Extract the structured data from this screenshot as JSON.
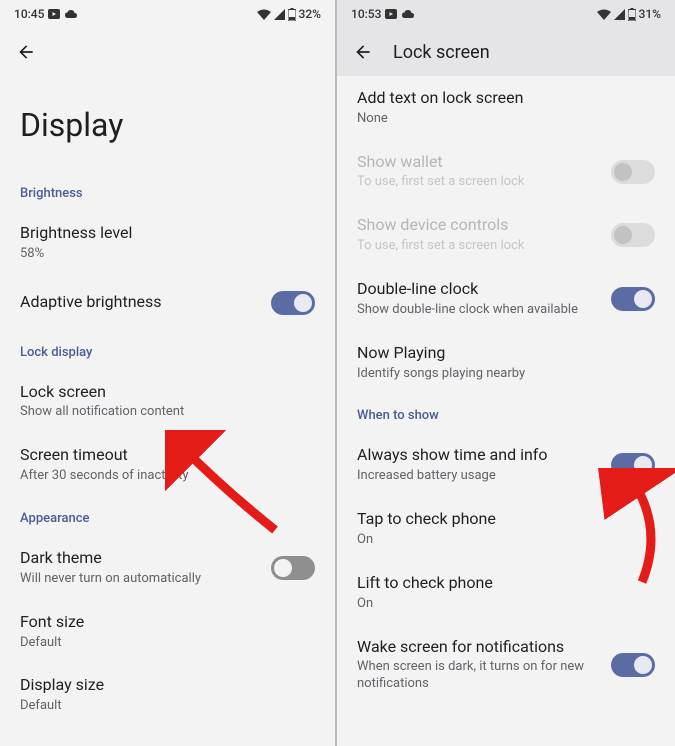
{
  "left": {
    "status": {
      "time": "10:45",
      "battery": "32%"
    },
    "title": "Display",
    "sections": [
      {
        "header": "Brightness",
        "items": [
          {
            "title": "Brightness level",
            "sub": "58%",
            "toggle": null
          },
          {
            "title": "Adaptive brightness",
            "sub": null,
            "toggle": "on"
          }
        ]
      },
      {
        "header": "Lock display",
        "items": [
          {
            "title": "Lock screen",
            "sub": "Show all notification content",
            "toggle": null
          },
          {
            "title": "Screen timeout",
            "sub": "After 30 seconds of inactivity",
            "toggle": null
          }
        ]
      },
      {
        "header": "Appearance",
        "items": [
          {
            "title": "Dark theme",
            "sub": "Will never turn on automatically",
            "toggle": "off"
          },
          {
            "title": "Font size",
            "sub": "Default",
            "toggle": null
          },
          {
            "title": "Display size",
            "sub": "Default",
            "toggle": null
          }
        ]
      }
    ]
  },
  "right": {
    "status": {
      "time": "10:53",
      "battery": "31%"
    },
    "title": "Lock screen",
    "preItems": [
      {
        "title": "Add text on lock screen",
        "sub": "None",
        "toggle": null,
        "disabled": false
      },
      {
        "title": "Show wallet",
        "sub": "To use, first set a screen lock",
        "toggle": "off-disabled",
        "disabled": true
      },
      {
        "title": "Show device controls",
        "sub": "To use, first set a screen lock",
        "toggle": "off-disabled",
        "disabled": true
      },
      {
        "title": "Double-line clock",
        "sub": "Show double-line clock when available",
        "toggle": "on",
        "disabled": false
      },
      {
        "title": "Now Playing",
        "sub": "Identify songs playing nearby",
        "toggle": null,
        "disabled": false
      }
    ],
    "sectionHeader": "When to show",
    "postItems": [
      {
        "title": "Always show time and info",
        "sub": "Increased battery usage",
        "toggle": "on"
      },
      {
        "title": "Tap to check phone",
        "sub": "On",
        "toggle": null
      },
      {
        "title": "Lift to check phone",
        "sub": "On",
        "toggle": null
      },
      {
        "title": "Wake screen for notifications",
        "sub": "When screen is dark, it turns on for new notifications",
        "toggle": "on"
      }
    ]
  }
}
